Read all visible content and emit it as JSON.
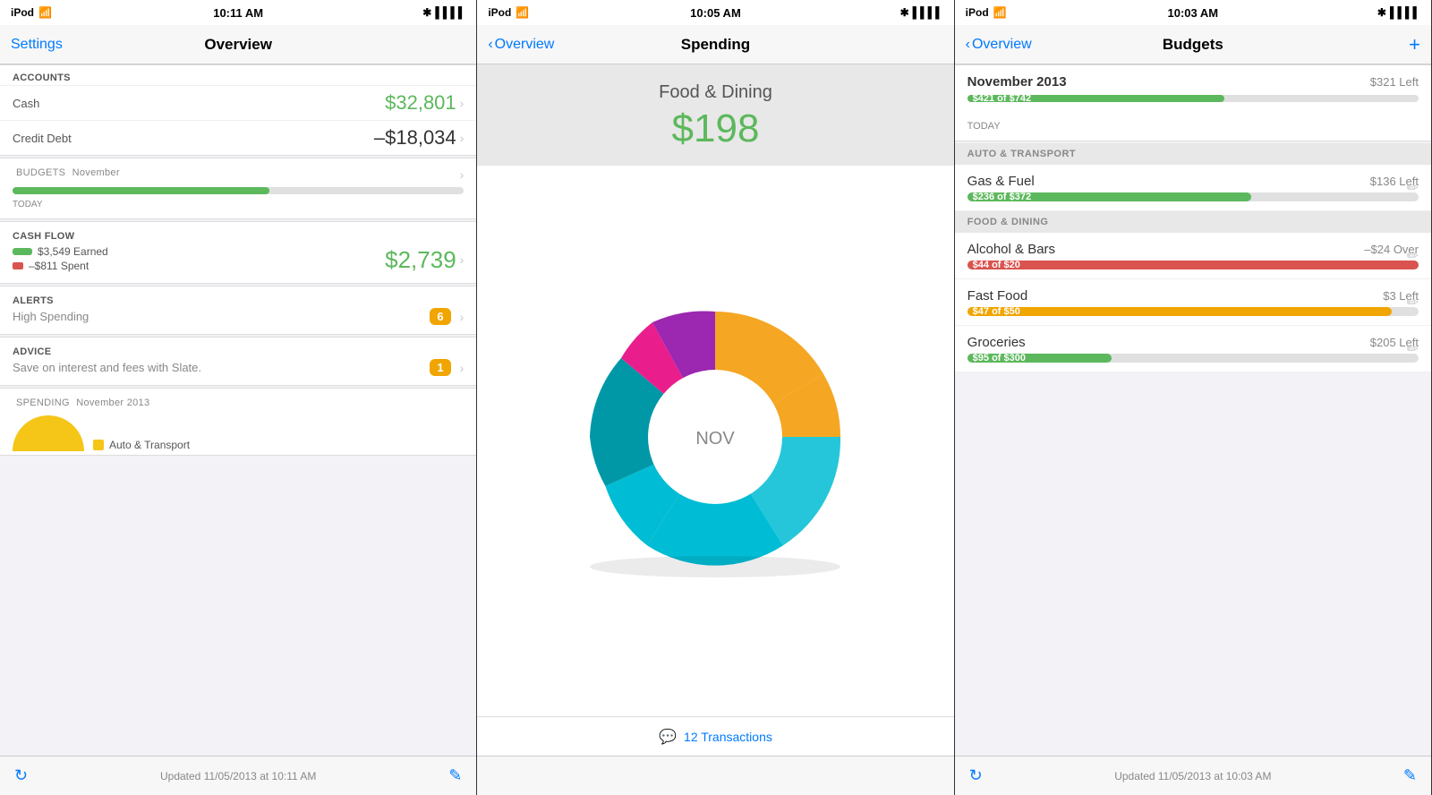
{
  "panels": [
    {
      "id": "overview",
      "statusBar": {
        "left": "iPod",
        "time": "10:11 AM",
        "right": "🔋"
      },
      "nav": {
        "leftLabel": "Settings",
        "title": "Overview",
        "rightLabel": null
      },
      "accounts": {
        "header": "ACCOUNTS",
        "items": [
          {
            "name": "Cash",
            "value": "$32,801",
            "type": "positive"
          },
          {
            "name": "Credit Debt",
            "value": "–$18,034",
            "type": "negative"
          }
        ]
      },
      "budgets": {
        "header": "BUDGETS",
        "subheader": "November",
        "progressPercent": 57,
        "todayLabel": "TODAY"
      },
      "cashflow": {
        "header": "CASH FLOW",
        "earned": "$3,549 Earned",
        "spent": "–$811 Spent",
        "total": "$2,739"
      },
      "alerts": {
        "header": "ALERTS",
        "sub": "High Spending",
        "badge": "6"
      },
      "advice": {
        "header": "ADVICE",
        "sub": "Save on interest and fees with Slate.",
        "badge": "1"
      },
      "spending": {
        "header": "SPENDING",
        "subheader": "November 2013",
        "legend": "Auto & Transport"
      },
      "bottomBar": {
        "text": "Updated 11/05/2013 at 10:11 AM"
      }
    },
    {
      "id": "spending",
      "statusBar": {
        "left": "iPod",
        "time": "10:05 AM",
        "right": "🔋"
      },
      "nav": {
        "leftLabel": "Overview",
        "title": "Spending",
        "rightLabel": null
      },
      "categoryName": "Food & Dining",
      "amount": "$198",
      "chart": {
        "segments": [
          {
            "color": "#f5a623",
            "startAngle": -90,
            "endAngle": 30,
            "label": "orange"
          },
          {
            "color": "#00bcd4",
            "startAngle": 30,
            "endAngle": 170,
            "label": "cyan"
          },
          {
            "color": "#26c6da",
            "startAngle": 170,
            "endAngle": 230,
            "label": "teal"
          },
          {
            "color": "#ff69b4",
            "startAngle": 230,
            "endAngle": 250,
            "label": "pink"
          },
          {
            "color": "#9c27b0",
            "startAngle": 250,
            "endAngle": 270,
            "label": "purple"
          }
        ],
        "centerLabel": "NOV"
      },
      "transactions": {
        "count": "12 Transactions"
      },
      "bottomBar": {
        "text": ""
      }
    },
    {
      "id": "budgets",
      "statusBar": {
        "left": "iPod",
        "time": "10:03 AM",
        "right": "🔋"
      },
      "nav": {
        "leftLabel": "Overview",
        "title": "Budgets",
        "rightLabel": "+"
      },
      "period": {
        "name": "November 2013",
        "left": "$321 Left",
        "barPercent": 57,
        "barLabel": "$421 of $742",
        "todayLabel": "TODAY"
      },
      "categories": [
        {
          "separator": "AUTO & TRANSPORT",
          "items": [
            {
              "name": "Gas & Fuel",
              "leftText": "$136 Left",
              "barPercent": 63,
              "barLabel": "$236 of $372",
              "barColor": "green",
              "over": false
            }
          ]
        },
        {
          "separator": "FOOD & DINING",
          "items": [
            {
              "name": "Alcohol & Bars",
              "leftText": "–$24 Over",
              "barPercent": 100,
              "barLabel": "$44 of $20",
              "barColor": "red",
              "over": true
            },
            {
              "name": "Fast Food",
              "leftText": "$3 Left",
              "barPercent": 94,
              "barLabel": "$47 of $50",
              "barColor": "yellow",
              "over": false
            },
            {
              "name": "Groceries",
              "leftText": "$205 Left",
              "barPercent": 32,
              "barLabel": "$95 of $300",
              "barColor": "green",
              "over": false
            }
          ]
        }
      ],
      "bottomBar": {
        "text": "Updated 11/05/2013 at 10:03 AM"
      }
    }
  ]
}
